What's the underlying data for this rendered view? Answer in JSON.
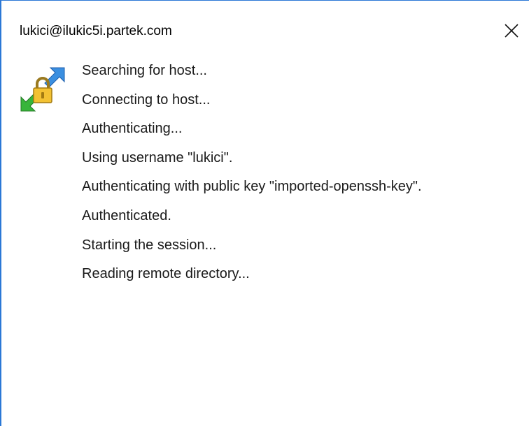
{
  "window": {
    "title": "lukici@ilukic5i.partek.com",
    "close_icon": "close-icon",
    "accent_color": "#2b78d6"
  },
  "status_icon": "connection-lock-icon",
  "log": [
    "Searching for host...",
    "Connecting to host...",
    "Authenticating...",
    "Using username \"lukici\".",
    "Authenticating with public key \"imported-openssh-key\".",
    "Authenticated.",
    "Starting the session...",
    "Reading remote directory..."
  ]
}
